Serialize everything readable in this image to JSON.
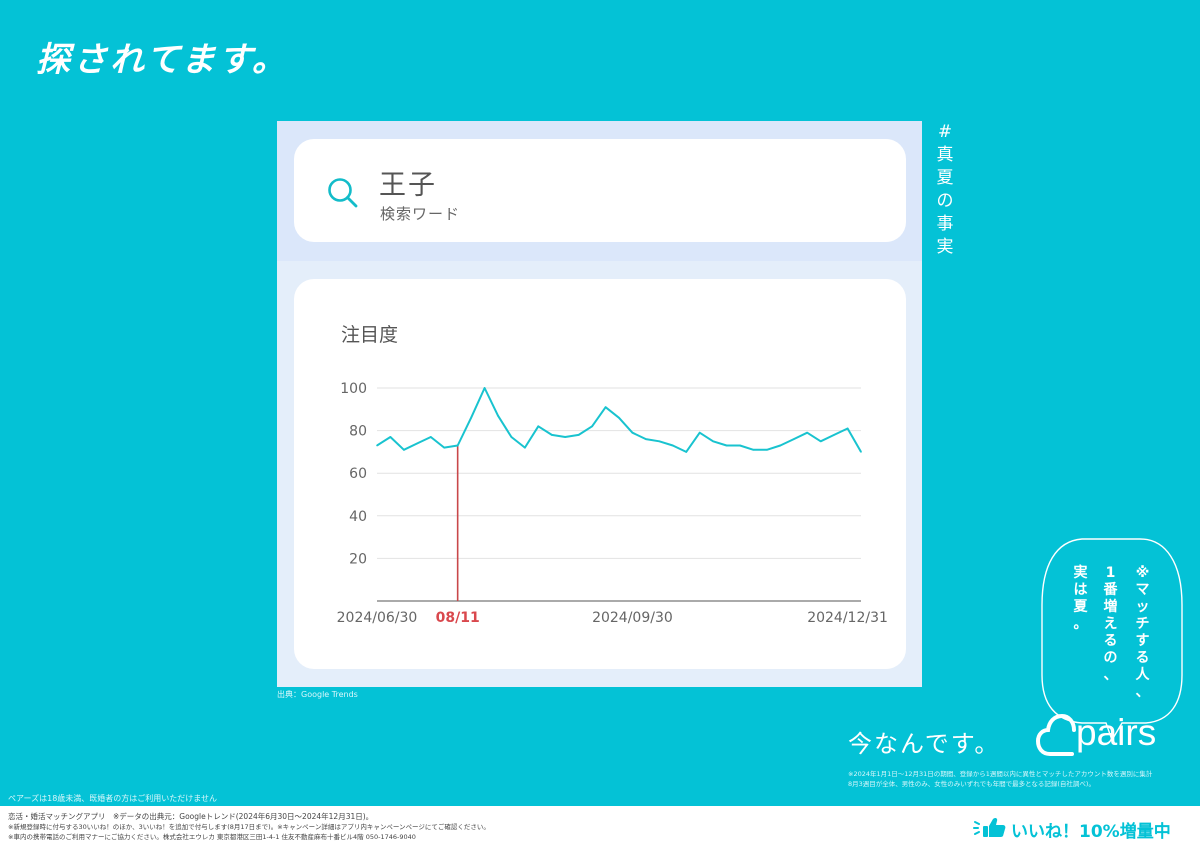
{
  "headline": "探されてます。",
  "search": {
    "icon": "search-icon",
    "term": "王子",
    "label": "検索ワード"
  },
  "chart_data": {
    "type": "line",
    "title": "注目度",
    "xlabel": "",
    "ylabel": "",
    "ylim": [
      0,
      100
    ],
    "yticks": [
      20,
      40,
      60,
      80,
      100
    ],
    "x_tick_labels": [
      {
        "label": "2024/06/30",
        "index": 0
      },
      {
        "label": "08/11",
        "index": 6,
        "highlight": true
      },
      {
        "label": "2024/09/30",
        "index": 19
      },
      {
        "label": "2024/12/31",
        "index": 35
      }
    ],
    "peak_marker_index": 6,
    "series": [
      {
        "values": [
          73,
          77,
          71,
          74,
          77,
          72,
          73,
          86,
          100,
          87,
          77,
          72,
          82,
          78,
          77,
          78,
          82,
          91,
          86,
          79,
          76,
          75,
          73,
          70,
          79,
          75,
          73,
          73,
          71,
          71,
          73,
          76,
          79,
          75,
          78,
          81,
          70
        ]
      }
    ],
    "line_color": "#19c3cf",
    "marker_color": "#c9474a",
    "grid": true
  },
  "source_note": "出典：Google Trends",
  "hashtag": [
    "#",
    "真",
    "夏",
    "の",
    "事",
    "実"
  ],
  "bubble": {
    "columns": [
      [
        "※",
        "マ",
        "ッ",
        "チ",
        "す",
        "る",
        "人",
        "、"
      ],
      [
        "1",
        "番",
        "増",
        "え",
        "る",
        "の",
        "、"
      ],
      [
        "実",
        "は",
        "夏",
        "。"
      ]
    ]
  },
  "tagline": "今なんです。",
  "brand": {
    "name": "pairs",
    "color": "#ffffff"
  },
  "fine_print_right": [
    "※2024年1月1日〜12月31日の期間、登録から1週間以内に異性とマッチしたアカウント数を週別に集計",
    "8月3週目が全体、男性のみ、女性のみいずれでも年間で最多となる記録(自社調べ)。"
  ],
  "age_notice": "ペアーズは18歳未満、既婚者の方はご利用いただけません",
  "footer": {
    "lines": [
      "恋活・婚活マッチングアプリ　※データの出典元：Googleトレンド(2024年6月30日〜2024年12月31日)。",
      "※新規登録時に付与する30いいね！のほか、3いいね！を追加で付与します(8月17日まで)。※キャンペーン詳細はアプリ内キャンペーンページにてご確認ください。",
      "※車内の携帯電話のご利用マナーにご協力ください。株式会社エウレカ 東京都港区三田1-4-1 住友不動産麻布十番ビル4階 050-1746-9040"
    ],
    "badge_icon": "thumbs-up-icon",
    "badge_text": "いいね！10%増量中",
    "badge_color": "#04c2d6"
  }
}
